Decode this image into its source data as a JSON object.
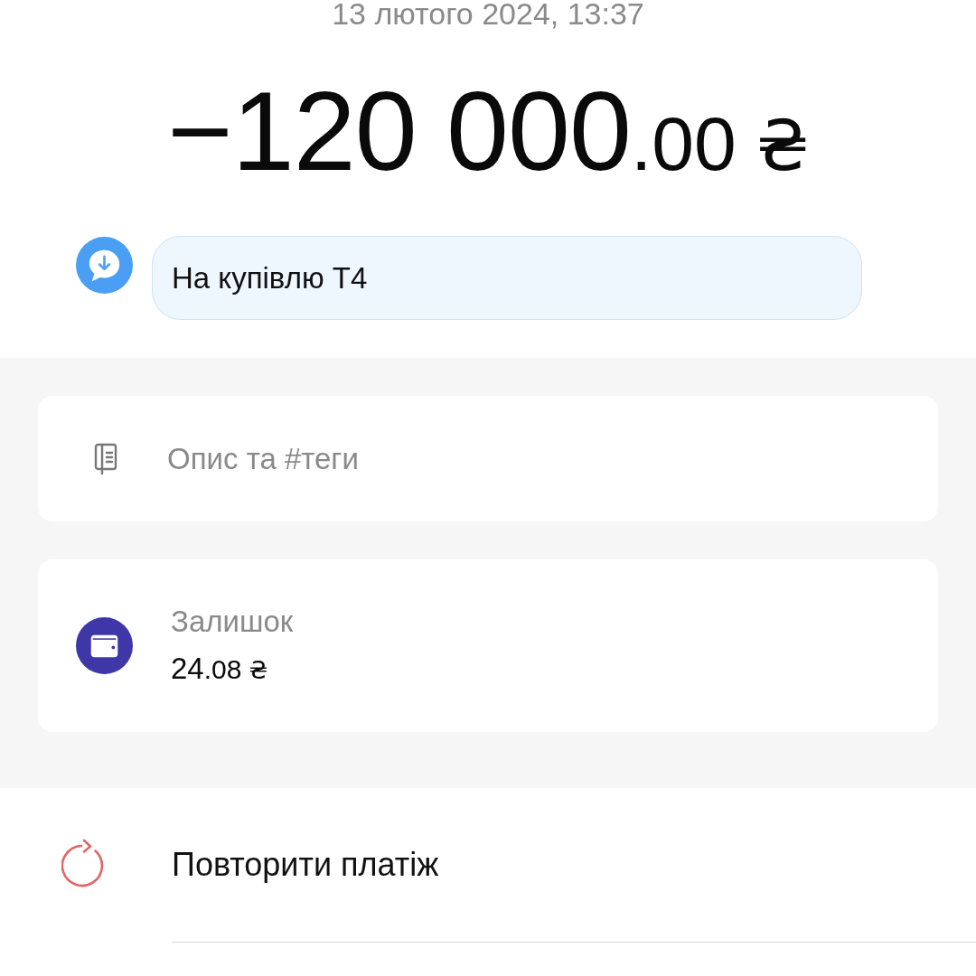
{
  "header": {
    "date": "13 лютого 2024, 13:37",
    "amount": {
      "whole": "−120 000",
      "fraction": ".00",
      "currency": "₴"
    }
  },
  "comment": {
    "text": "На купівлю Т4"
  },
  "description": {
    "placeholder": "Опис та #теги"
  },
  "balance": {
    "label": "Залишок",
    "amount": {
      "whole": "24",
      "fraction": ".08",
      "currency": "₴"
    }
  },
  "actions": [
    {
      "kind": "repeat",
      "label": "Повторити платіж"
    }
  ]
}
